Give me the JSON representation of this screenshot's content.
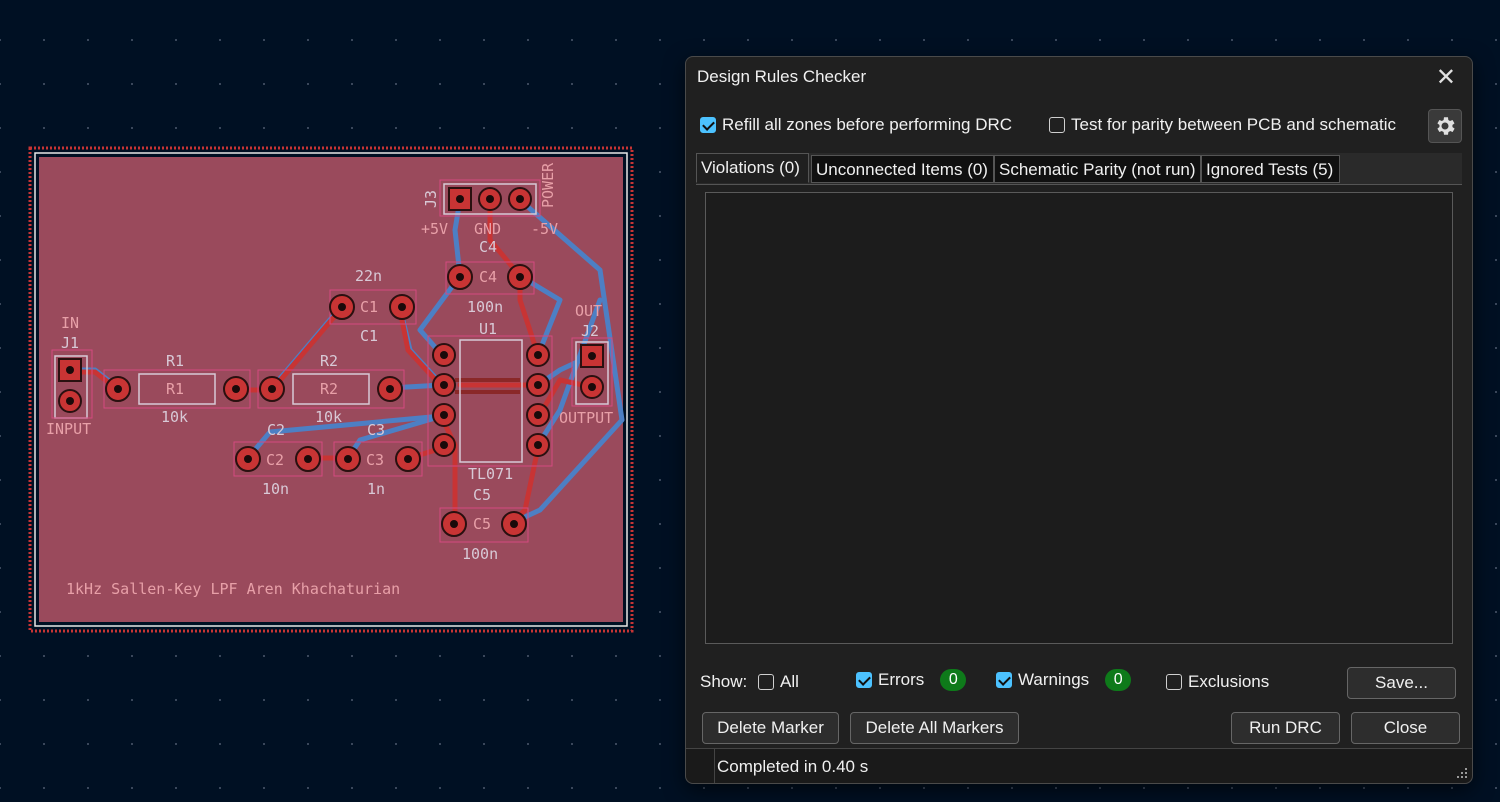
{
  "dialog": {
    "title": "Design Rules Checker",
    "refill_label": "Refill all zones before performing DRC",
    "refill_checked": true,
    "parity_label": "Test for parity between PCB and schematic",
    "parity_checked": false,
    "tabs": [
      {
        "label": "Violations (0)",
        "active": true
      },
      {
        "label": "Unconnected Items (0)",
        "active": false
      },
      {
        "label": "Schematic Parity (not run)",
        "active": false
      },
      {
        "label": "Ignored Tests (5)",
        "active": false
      }
    ],
    "show_label": "Show:",
    "filters": {
      "all": {
        "label": "All",
        "checked": false
      },
      "errors": {
        "label": "Errors",
        "checked": true,
        "count": "0"
      },
      "warnings": {
        "label": "Warnings",
        "checked": true,
        "count": "0"
      },
      "exclusions": {
        "label": "Exclusions",
        "checked": false
      }
    },
    "buttons": {
      "save": "Save...",
      "delete_marker": "Delete Marker",
      "delete_all_markers": "Delete All Markers",
      "run_drc": "Run DRC",
      "close": "Close"
    },
    "status": "Completed in 0.40 s"
  },
  "pcb": {
    "title_text": "1kHz Sallen-Key LPF Aren Khachaturian",
    "labels": {
      "in": "IN",
      "j1": "J1",
      "input": "INPUT",
      "r1": "R1",
      "r1_val": "10k",
      "r2": "R2",
      "r2_val": "10k",
      "c1_val": "22n",
      "c1": "C1",
      "c2": "C2",
      "c2_val": "10n",
      "c3": "C3",
      "c3_val": "1n",
      "c4": "C4",
      "c4_val": "100n",
      "c5": "C5",
      "c5_val": "100n",
      "u1": "U1",
      "u1_val": "TL071",
      "out": "OUT",
      "j2": "J2",
      "output": "OUTPUT",
      "j3": "J3",
      "power": "POWER",
      "p5v": "+5V",
      "gnd": "GND",
      "m5v": "-5V"
    }
  },
  "colors": {
    "board": "#9a4a5c",
    "copper": "#c83434",
    "trace_blue": "#4d7fc4",
    "accent": "#4cc2ff",
    "badge_green": "#0e7a1a"
  }
}
